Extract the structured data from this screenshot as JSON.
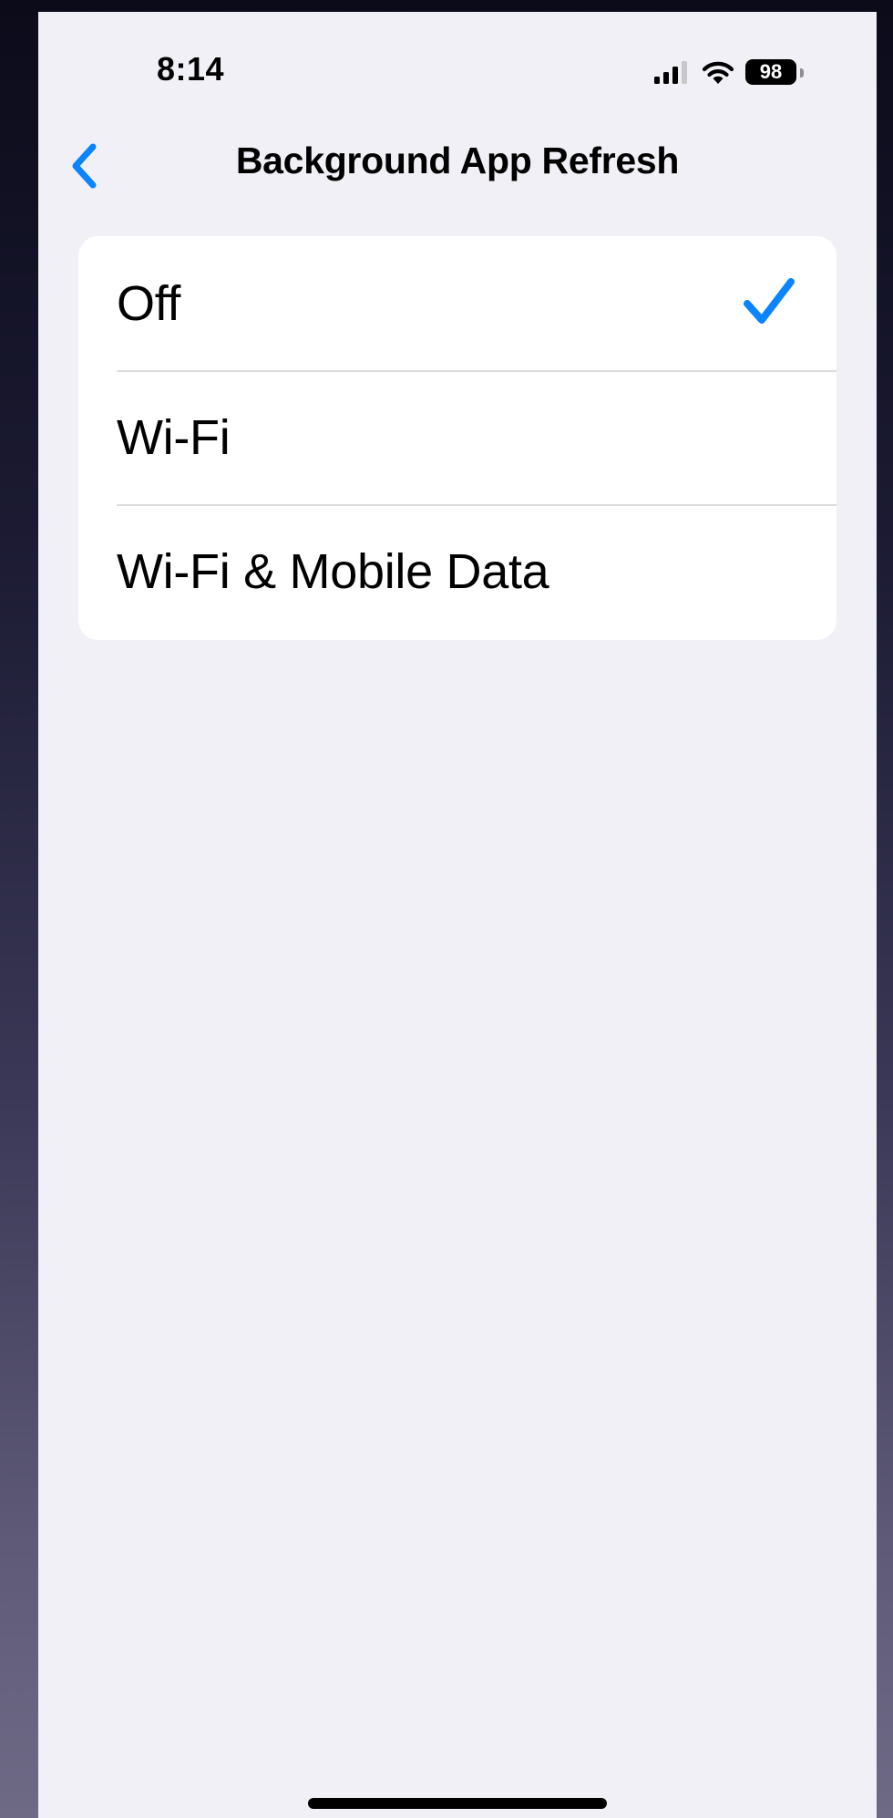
{
  "status_bar": {
    "time": "8:14",
    "battery_level": "98",
    "icons": [
      "signal-icon",
      "wifi-icon",
      "battery-icon"
    ]
  },
  "nav": {
    "back_icon": "chevron-left-icon",
    "title": "Background App Refresh"
  },
  "options": [
    {
      "label": "Off",
      "selected": true
    },
    {
      "label": "Wi-Fi",
      "selected": false
    },
    {
      "label": "Wi-Fi & Mobile Data",
      "selected": false
    }
  ],
  "colors": {
    "accent": "#0a84ff",
    "background": "#f1f0f6",
    "card": "#ffffff"
  }
}
